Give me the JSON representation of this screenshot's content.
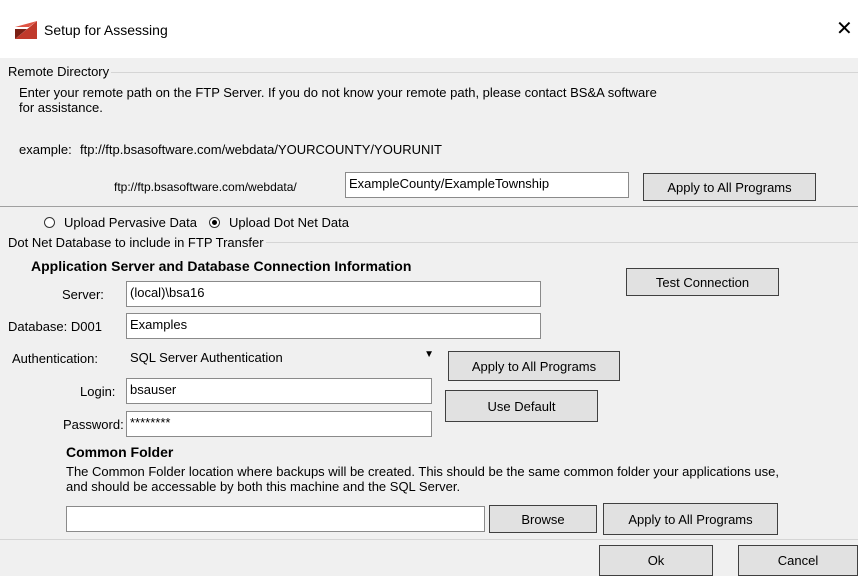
{
  "window": {
    "title": "Setup for Assessing",
    "close_glyph": "✕"
  },
  "remote": {
    "group_label": "Remote Directory",
    "instructions": "Enter your remote path on the FTP Server.  If you do not know your remote path, please contact BS&A software for assistance.",
    "example_label": "example:",
    "example_value": "ftp://ftp.bsasoftware.com/webdata/YOURCOUNTY/YOURUNIT",
    "prefix": "ftp://ftp.bsasoftware.com/webdata/",
    "path_value": "ExampleCounty/ExampleTownship",
    "apply_label": "Apply to All Programs"
  },
  "upload": {
    "pervasive_label": "Upload Pervasive Data",
    "dotnet_label": "Upload Dot Net Data",
    "selected": "dotnet"
  },
  "dotnet": {
    "group_label": "Dot Net Database to include in FTP Transfer",
    "heading": "Application Server and Database Connection Information",
    "test_label": "Test Connection",
    "server_label": "Server:",
    "server_value": "(local)\\bsa16",
    "database_label": "Database: D001",
    "database_value": "Examples",
    "auth_label": "Authentication:",
    "auth_value": "SQL Server Authentication",
    "apply_label": "Apply to All Programs",
    "login_label": "Login:",
    "login_value": "bsauser",
    "password_label": "Password:",
    "password_value": "********",
    "default_label": "Use Default"
  },
  "common": {
    "heading": "Common Folder",
    "description": "The Common Folder location where backups will be created. This should be the same common folder your applications use, and should be accessable by both this machine and the SQL Server.",
    "path_value": "",
    "browse_label": "Browse",
    "apply_label": "Apply to All Programs"
  },
  "footer": {
    "ok_label": "Ok",
    "cancel_label": "Cancel"
  },
  "colors": {
    "icon_red": "#c0392b",
    "icon_dark": "#7a1f14"
  }
}
